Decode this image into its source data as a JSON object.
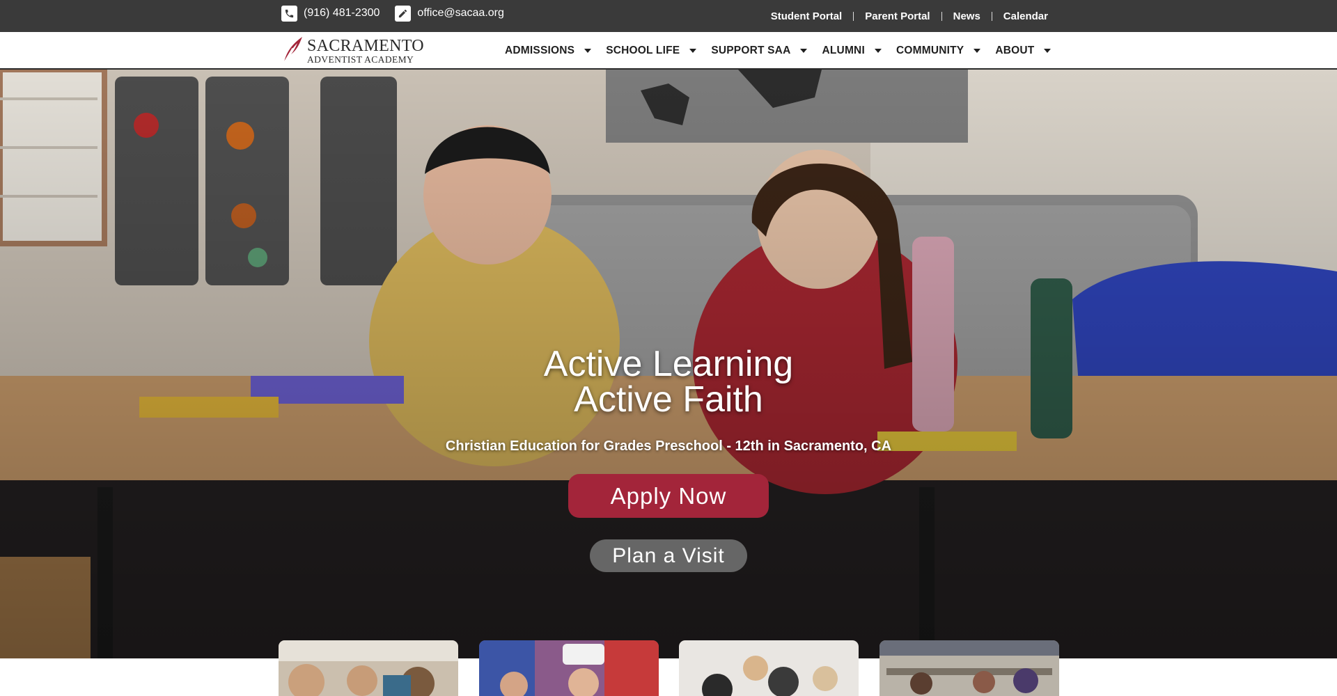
{
  "topbar": {
    "phone": "(916) 481-2300",
    "email": "office@sacaa.org",
    "links": [
      "Student Portal",
      "Parent Portal",
      "News",
      "Calendar"
    ]
  },
  "logo": {
    "line1": "SACRAMENTO",
    "line2": "ADVENTIST ACADEMY"
  },
  "nav": {
    "items": [
      "ADMISSIONS",
      "SCHOOL LIFE",
      "SUPPORT SAA",
      "ALUMNI",
      "COMMUNITY",
      "ABOUT"
    ]
  },
  "hero": {
    "title_line1": "Active Learning",
    "title_line2": "Active Faith",
    "subtitle": "Christian Education for Grades Preschool - 12th in Sacramento, CA",
    "apply_label": "Apply Now",
    "visit_label": "Plan a Visit"
  },
  "colors": {
    "topbar_bg": "#3a3a3a",
    "apply_button": "#a3253a",
    "logo_accent": "#a3253a"
  },
  "icons": {
    "phone": "phone-icon",
    "email": "pencil-square-icon",
    "logo": "feather-icon",
    "dropdown": "caret-down-icon"
  }
}
